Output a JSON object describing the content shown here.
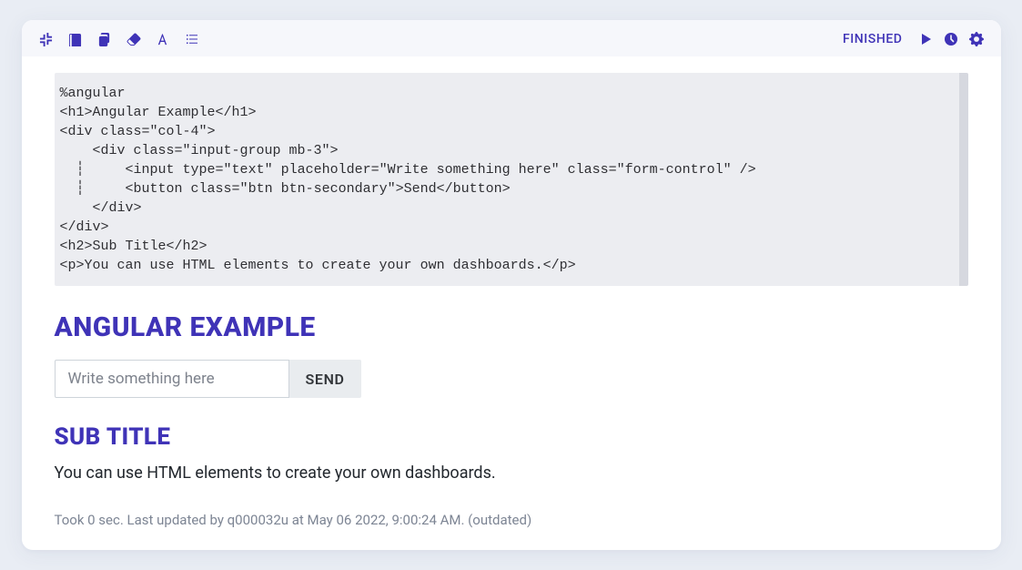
{
  "toolbar": {
    "status": "FINISHED"
  },
  "code": "%angular\n<h1>Angular Example</h1>\n<div class=\"col-4\">\n    <div class=\"input-group mb-3\">\n  ┆     <input type=\"text\" placeholder=\"Write something here\" class=\"form-control\" />\n  ┆     <button class=\"btn btn-secondary\">Send</button>\n    </div>\n</div>\n<h2>Sub Title</h2>\n<p>You can use HTML elements to create your own dashboards.</p>",
  "output": {
    "h1": "ANGULAR EXAMPLE",
    "input_placeholder": "Write something here",
    "send_label": "SEND",
    "h2": "SUB TITLE",
    "paragraph": "You can use HTML elements to create your own dashboards."
  },
  "meta": "Took 0 sec. Last updated by q000032u at May 06 2022, 9:00:24 AM. (outdated)"
}
